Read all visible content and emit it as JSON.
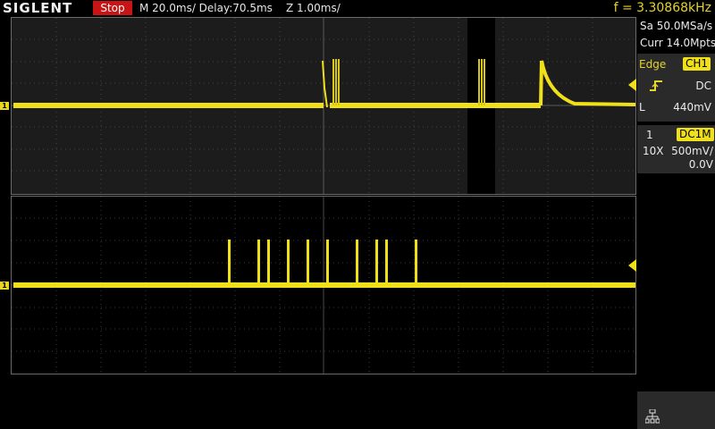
{
  "header": {
    "brand": "SIGLENT",
    "run_state": "Stop",
    "timebase": "M 20.0ms/ Delay:70.5ms",
    "zoom_timebase": "Z 1.00ms/",
    "frequency": "f = 3.30868kHz"
  },
  "acquisition": {
    "sample_rate": "Sa 50.0MSa/s",
    "memory_depth": "Curr 14.0Mpts"
  },
  "trigger": {
    "type": "Edge",
    "source": "CH1",
    "coupling": "DC",
    "level_label": "L",
    "level": "440mV",
    "slope_icon": "rising-edge-icon"
  },
  "channel1": {
    "number": "1",
    "coupling_impedance": "DC1M",
    "probe": "10X",
    "scale": "500mV/",
    "offset": "0.0V",
    "marker_label": "1",
    "color": "#f0e01a"
  },
  "bottom_icon": "network-icon",
  "colors": {
    "trace": "#f0e01a",
    "trigger_marker": "#1ea0e6",
    "stop_badge": "#c81414"
  }
}
